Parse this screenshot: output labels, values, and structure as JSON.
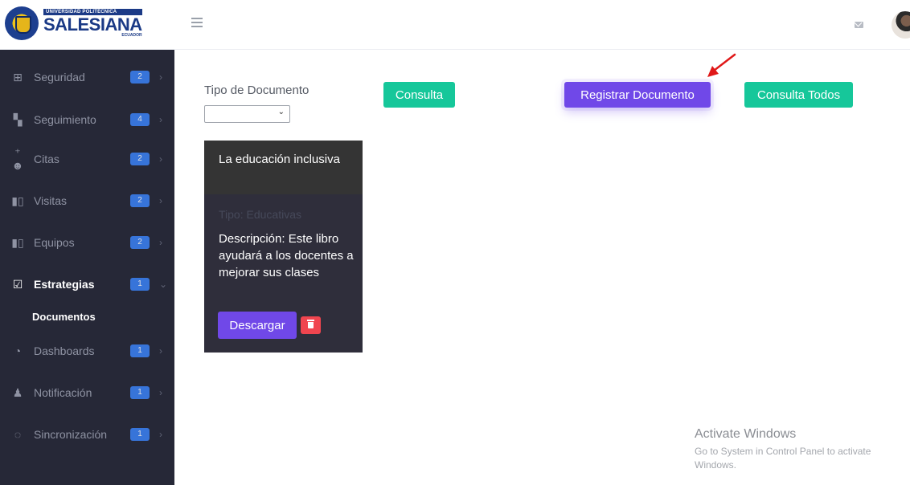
{
  "brand": {
    "top_line": "UNIVERSIDAD POLITÉCNICA",
    "name": "SALESIANA",
    "country": "ECUADOR"
  },
  "sidebar": {
    "items": [
      {
        "label": "Seguridad",
        "icon": "table-icon",
        "badge": "2"
      },
      {
        "label": "Seguimiento",
        "icon": "binoculars-icon",
        "badge": "4"
      },
      {
        "label": "Citas",
        "icon": "users-plus-icon",
        "badge": "2"
      },
      {
        "label": "Visitas",
        "icon": "book-open-icon",
        "badge": "2"
      },
      {
        "label": "Equipos",
        "icon": "book-open-icon",
        "badge": "2"
      },
      {
        "label": "Estrategias",
        "icon": "clipboard-check-icon",
        "badge": "1"
      },
      {
        "label": "Dashboards",
        "icon": "gauge-icon",
        "badge": "1"
      },
      {
        "label": "Notificación",
        "icon": "bell-icon",
        "badge": "1"
      },
      {
        "label": "Sincronización",
        "icon": "sync-icon",
        "badge": "1"
      }
    ],
    "sub_item": "Documentos"
  },
  "filter": {
    "label": "Tipo de Documento",
    "selected": ""
  },
  "buttons": {
    "consulta": "Consulta",
    "registrar": "Registrar Documento",
    "consulta_todos": "Consulta Todos"
  },
  "card": {
    "title": "La educación inclusiva",
    "type": "Tipo: Educativas",
    "description": "Descripción: Este libro ayudará a los docentes a mejorar sus clases",
    "download": "Descargar"
  },
  "watermark": {
    "title": "Activate Windows",
    "text": "Go to System in Control Panel to activate Windows."
  },
  "colors": {
    "sidebar_bg": "#262837",
    "accent_green": "#16c79a",
    "accent_purple": "#7048e8",
    "badge_blue": "#3b82f6",
    "danger": "#f0454f"
  }
}
